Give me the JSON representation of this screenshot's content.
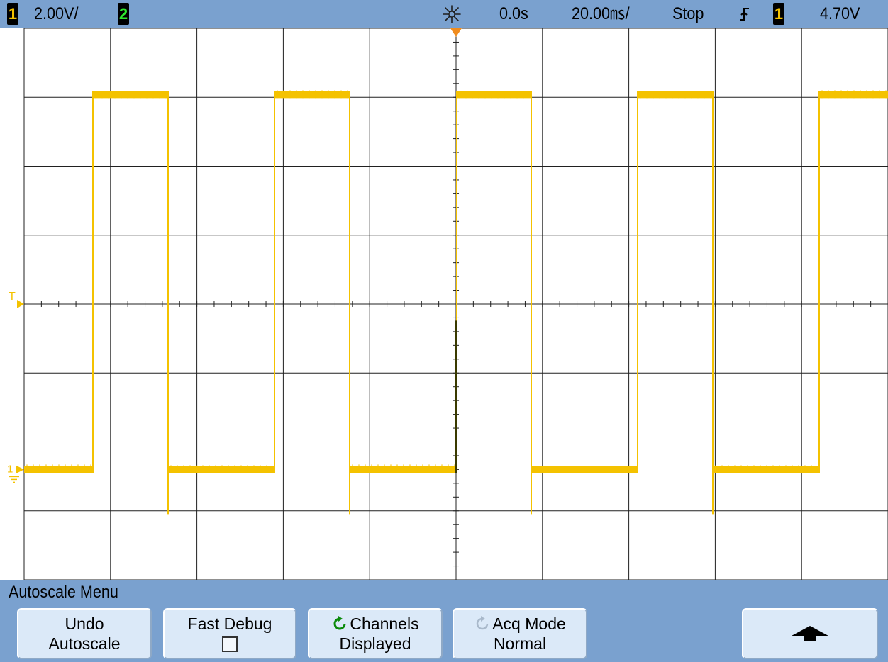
{
  "status_bar": {
    "channel1_label": "1",
    "channel1_scale": "2.00V/",
    "channel2_label": "2",
    "acquisition_icon": "acquisition-spark-icon",
    "time_offset": "0.0s",
    "timebase": "20.00㎳/",
    "run_state": "Stop",
    "trigger_slope_icon": "rising-edge-icon",
    "trigger_source": "1",
    "trigger_level": "4.70V"
  },
  "colors": {
    "channel1": "#f4c200",
    "channel2": "#2ee82e",
    "bar_background": "#7aa1cf",
    "softkey_background": "#dbe9f8",
    "trigger_marker": "#f08c1e"
  },
  "waveform": {
    "channel": "1",
    "shape": "square",
    "levels": [
      "high",
      "low"
    ],
    "segments": [
      {
        "level": "low"
      },
      {
        "level": "high"
      },
      {
        "level": "low"
      },
      {
        "level": "high"
      },
      {
        "level": "low"
      },
      {
        "level": "high"
      },
      {
        "level": "low"
      },
      {
        "level": "high"
      },
      {
        "level": "low"
      },
      {
        "level": "high"
      }
    ]
  },
  "screen_markers": {
    "trigger_level_marker": "T",
    "channel1_ground_marker": "1"
  },
  "menu": {
    "title": "Autoscale Menu",
    "softkeys": [
      {
        "line1": "Undo",
        "line2": "Autoscale"
      },
      {
        "line1": "Fast Debug",
        "checkbox_checked": false
      },
      {
        "line1": "Channels",
        "line2": "Displayed",
        "icon": "cycle-arrow-icon",
        "icon_active": true
      },
      {
        "line1": "Acq Mode",
        "line2": "Normal",
        "icon": "cycle-arrow-icon",
        "icon_active": false
      },
      {
        "icon": "up-arrow-icon"
      }
    ]
  }
}
